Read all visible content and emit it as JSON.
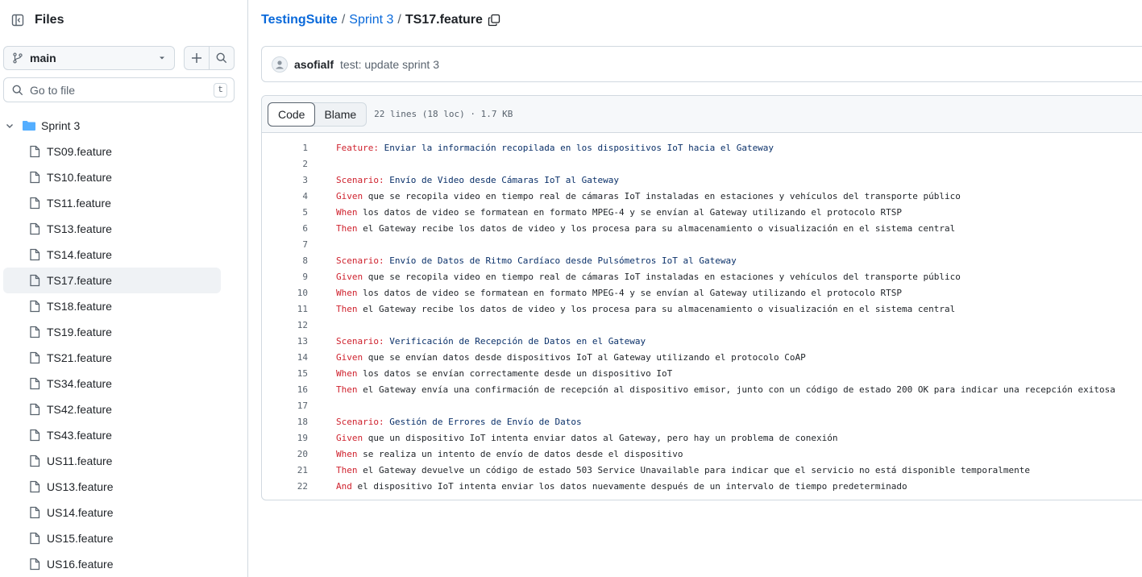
{
  "sidebar": {
    "title": "Files",
    "branch": "main",
    "goto_placeholder": "Go to file",
    "goto_shortcut": "t",
    "folder": "Sprint 3",
    "files": [
      {
        "name": "TS09.feature",
        "active": false
      },
      {
        "name": "TS10.feature",
        "active": false
      },
      {
        "name": "TS11.feature",
        "active": false
      },
      {
        "name": "TS13.feature",
        "active": false
      },
      {
        "name": "TS14.feature",
        "active": false
      },
      {
        "name": "TS17.feature",
        "active": true
      },
      {
        "name": "TS18.feature",
        "active": false
      },
      {
        "name": "TS19.feature",
        "active": false
      },
      {
        "name": "TS21.feature",
        "active": false
      },
      {
        "name": "TS34.feature",
        "active": false
      },
      {
        "name": "TS42.feature",
        "active": false
      },
      {
        "name": "TS43.feature",
        "active": false
      },
      {
        "name": "US11.feature",
        "active": false
      },
      {
        "name": "US13.feature",
        "active": false
      },
      {
        "name": "US14.feature",
        "active": false
      },
      {
        "name": "US15.feature",
        "active": false
      },
      {
        "name": "US16.feature",
        "active": false
      }
    ]
  },
  "breadcrumb": {
    "repo": "TestingSuite",
    "sep1": "/",
    "folder": "Sprint 3",
    "sep2": "/",
    "file": "TS17.feature"
  },
  "commit": {
    "author": "asofialf",
    "message": "test: update sprint 3"
  },
  "viewer": {
    "tab_code": "Code",
    "tab_blame": "Blame",
    "meta": "22 lines (18 loc) · 1.7 KB"
  },
  "colors": {
    "link": "#0969da",
    "keyword": "#cf222e",
    "title": "#0a3069",
    "folder_icon": "#54aeff"
  },
  "code_lines": [
    {
      "n": "1",
      "kw": "Feature:",
      "text": " Enviar la información recopilada en los dispositivos IoT hacia el Gateway",
      "title": true
    },
    {
      "n": "2",
      "kw": "",
      "text": "",
      "title": false
    },
    {
      "n": "3",
      "kw": "Scenario:",
      "text": " Envío de Video desde Cámaras IoT al Gateway",
      "title": true
    },
    {
      "n": "4",
      "kw": "Given",
      "text": " que se recopila video en tiempo real de cámaras IoT instaladas en estaciones y vehículos del transporte público",
      "title": false
    },
    {
      "n": "5",
      "kw": "When",
      "text": " los datos de video se formatean en formato MPEG-4 y se envían al Gateway utilizando el protocolo RTSP",
      "title": false
    },
    {
      "n": "6",
      "kw": "Then",
      "text": " el Gateway recibe los datos de video y los procesa para su almacenamiento o visualización en el sistema central",
      "title": false
    },
    {
      "n": "7",
      "kw": "",
      "text": "",
      "title": false
    },
    {
      "n": "8",
      "kw": "Scenario:",
      "text": " Envío de Datos de Ritmo Cardíaco desde Pulsómetros IoT al Gateway",
      "title": true
    },
    {
      "n": "9",
      "kw": "Given",
      "text": " que se recopila video en tiempo real de cámaras IoT instaladas en estaciones y vehículos del transporte público",
      "title": false
    },
    {
      "n": "10",
      "kw": "When",
      "text": " los datos de video se formatean en formato MPEG-4 y se envían al Gateway utilizando el protocolo RTSP",
      "title": false
    },
    {
      "n": "11",
      "kw": "Then",
      "text": " el Gateway recibe los datos de video y los procesa para su almacenamiento o visualización en el sistema central",
      "title": false
    },
    {
      "n": "12",
      "kw": "",
      "text": "",
      "title": false
    },
    {
      "n": "13",
      "kw": "Scenario:",
      "text": " Verificación de Recepción de Datos en el Gateway",
      "title": true
    },
    {
      "n": "14",
      "kw": "Given",
      "text": " que se envían datos desde dispositivos IoT al Gateway utilizando el protocolo CoAP",
      "title": false
    },
    {
      "n": "15",
      "kw": "When",
      "text": " los datos se envían correctamente desde un dispositivo IoT",
      "title": false
    },
    {
      "n": "16",
      "kw": "Then",
      "text": " el Gateway envía una confirmación de recepción al dispositivo emisor, junto con un código de estado 200 OK para indicar una recepción exitosa",
      "title": false
    },
    {
      "n": "17",
      "kw": "",
      "text": "",
      "title": false
    },
    {
      "n": "18",
      "kw": "Scenario:",
      "text": " Gestión de Errores de Envío de Datos",
      "title": true
    },
    {
      "n": "19",
      "kw": "Given",
      "text": " que un dispositivo IoT intenta enviar datos al Gateway, pero hay un problema de conexión",
      "title": false
    },
    {
      "n": "20",
      "kw": "When",
      "text": " se realiza un intento de envío de datos desde el dispositivo",
      "title": false
    },
    {
      "n": "21",
      "kw": "Then",
      "text": " el Gateway devuelve un código de estado 503 Service Unavailable para indicar que el servicio no está disponible temporalmente",
      "title": false
    },
    {
      "n": "22",
      "kw": "And",
      "text": " el dispositivo IoT intenta enviar los datos nuevamente después de un intervalo de tiempo predeterminado",
      "title": false
    }
  ]
}
